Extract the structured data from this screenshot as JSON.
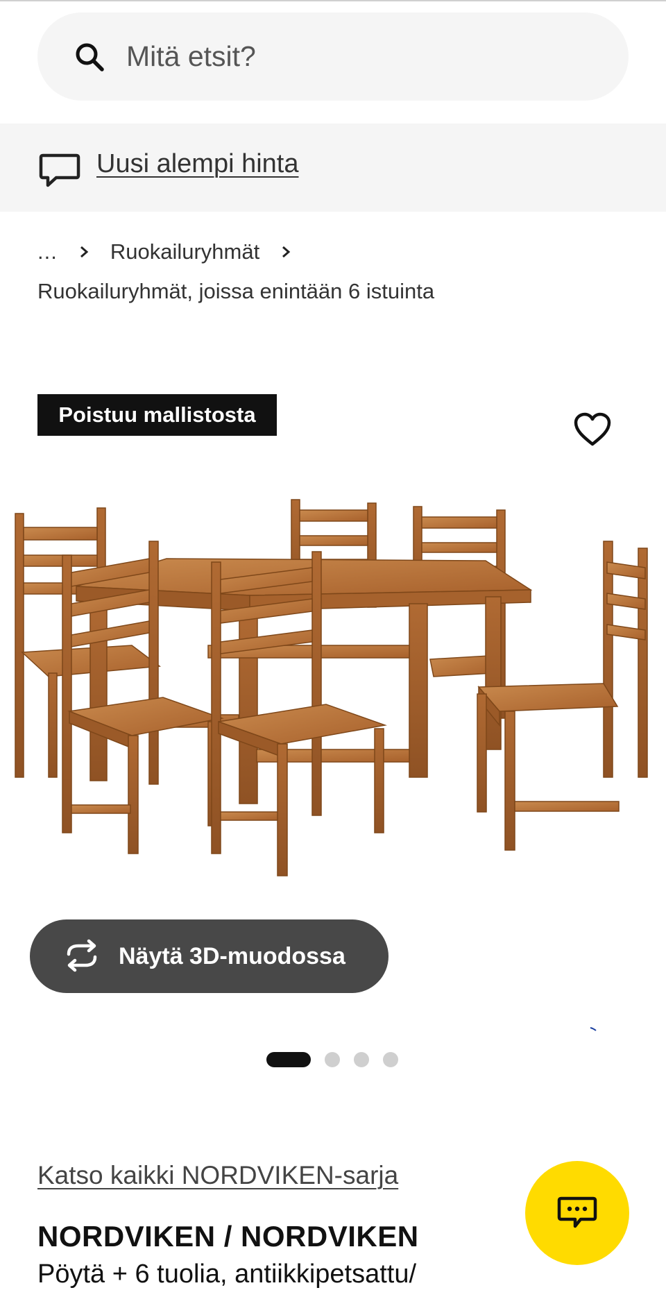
{
  "search": {
    "placeholder": "Mitä etsit?",
    "icon": "search-icon"
  },
  "notice": {
    "icon": "speech-bubble-icon",
    "label": "Uusi alempi hinta"
  },
  "breadcrumb": {
    "ellipsis": "...",
    "items": [
      "Ruokailuryhmät"
    ],
    "current": "Ruokailuryhmät, joissa enintään 6 istuinta"
  },
  "product": {
    "badge": "Poistuu mallistosta",
    "favourite_icon": "heart-outline-icon",
    "image_alt": "NORDVIKEN dining table with six chairs, antique stain",
    "view_3d_label": "Näytä 3D-muodossa",
    "view_3d_icon": "rotate-arrows-icon",
    "carousel": {
      "total": 4,
      "active": 1
    },
    "series_link": "Katso kaikki NORDVIKEN-sarja",
    "name": "NORDVIKEN / NORDVIKEN",
    "description": "Pöytä + 6 tuolia, antiikkipetsattu/"
  },
  "chat": {
    "icon": "chat-bubble-icon"
  },
  "colors": {
    "accent_yellow": "#ffdb00",
    "search_bg": "#f5f5f5",
    "badge_bg": "#111111",
    "button_3d_bg": "#484848",
    "wood": "#b8733a"
  }
}
